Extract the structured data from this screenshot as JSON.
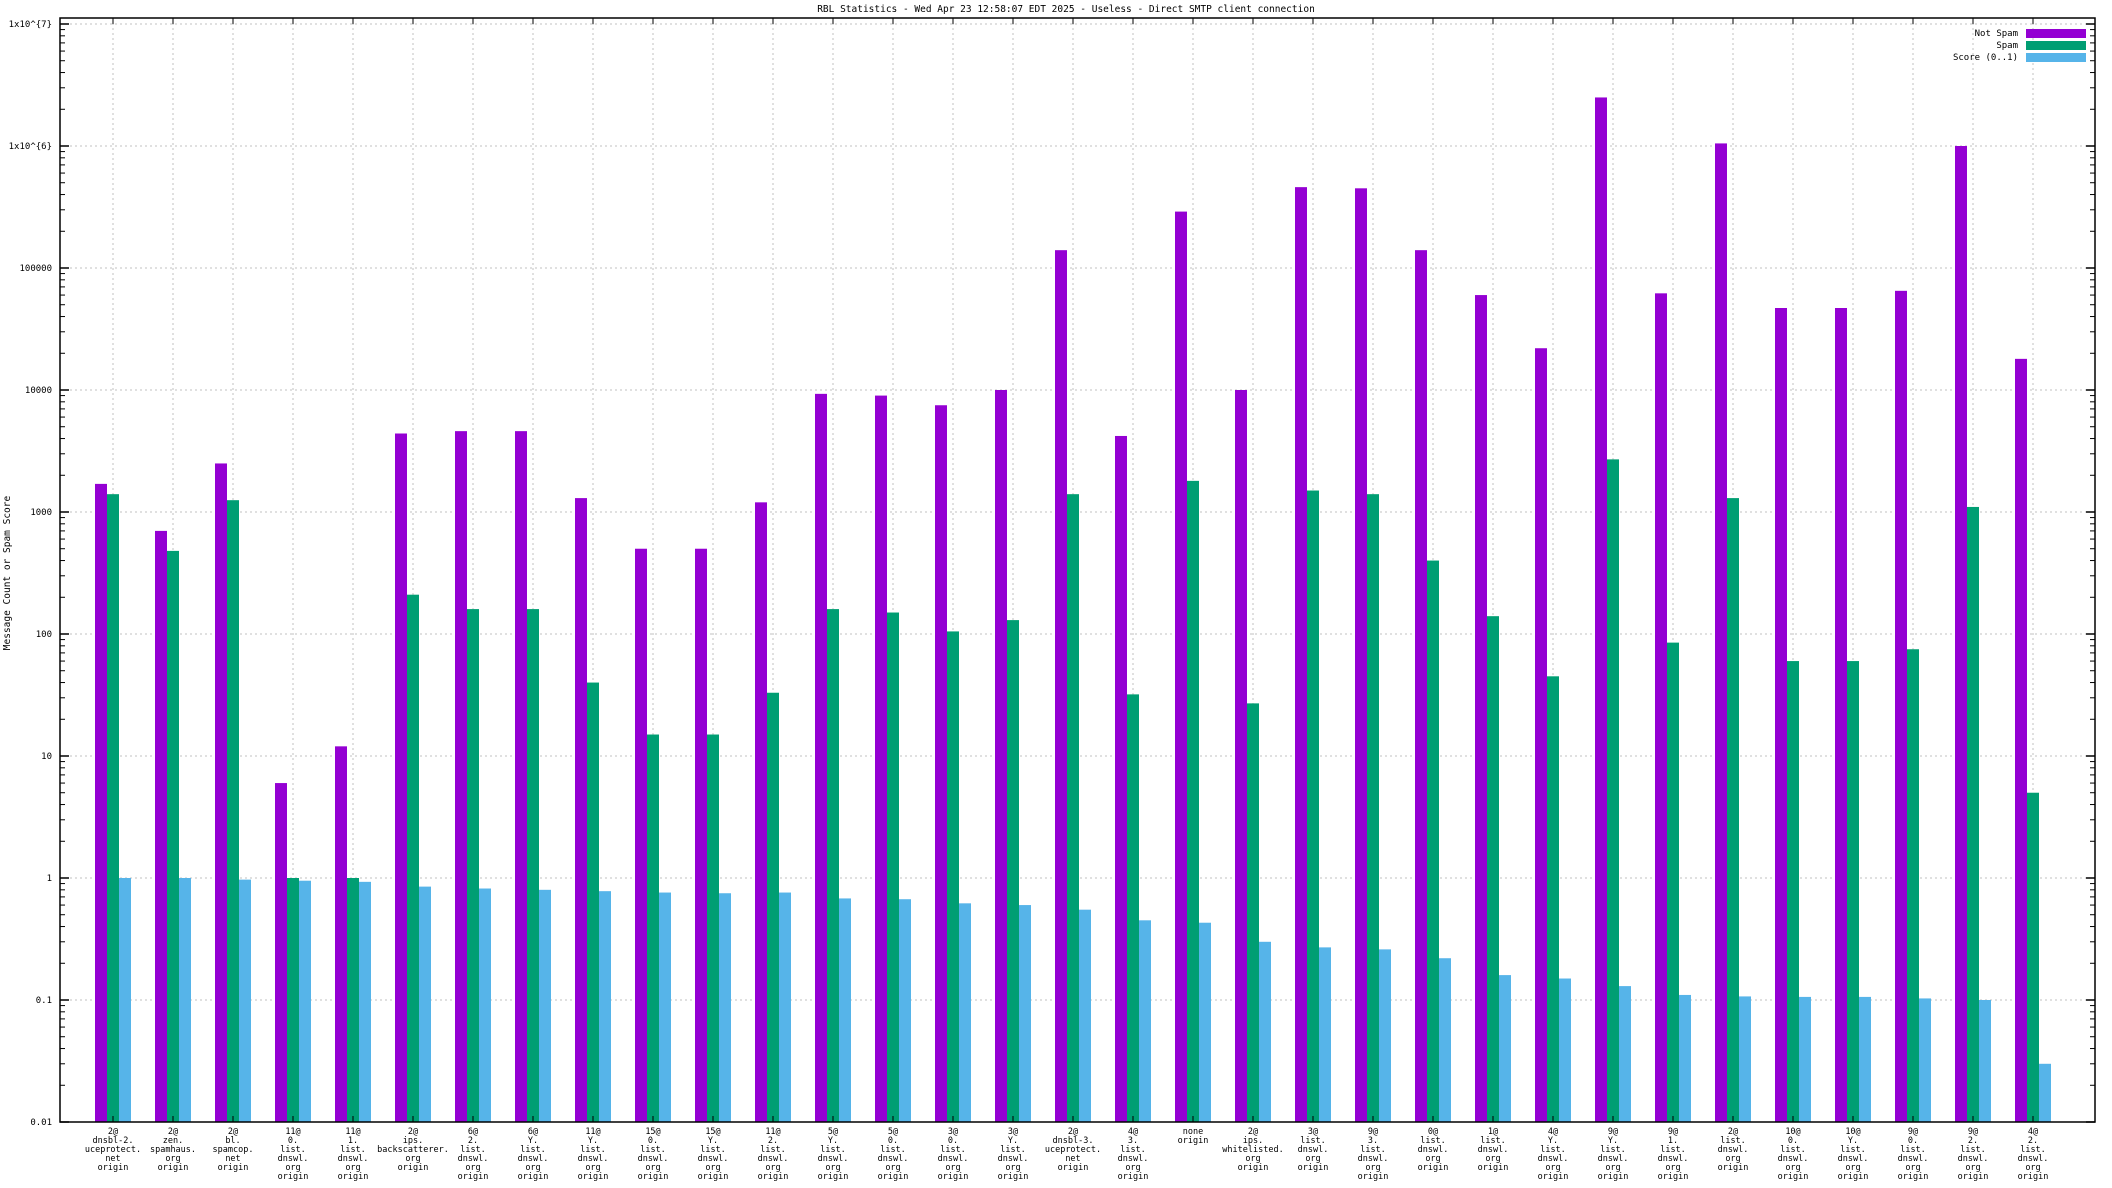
{
  "window": {
    "title": "RBL Statistics - Wed Apr 23 12:58:07 EDT 2025 - Useless - Direct SMTP client connection"
  },
  "colors": {
    "not_spam": "#9400d3",
    "spam": "#009e73",
    "score": "#56b4e9",
    "grid": "#c0c0c0",
    "border": "#000000",
    "background": "#ffffff"
  },
  "chart_data": {
    "type": "bar",
    "title": "RBL Statistics - Wed Apr 23 12:58:07 EDT 2025 - Useless - Direct SMTP client connection",
    "xlabel": "",
    "ylabel": "Message Count or Spam Score",
    "yscale": "log",
    "ylim": [
      0.01,
      10000000
    ],
    "grid": true,
    "legend_position": "top-right",
    "ytick_labels": [
      "1x10^{7}",
      "1x10^{6}",
      "100000",
      "10000",
      "1000",
      "100",
      "10",
      "1",
      "0.1",
      "0.01"
    ],
    "ytick_values": [
      10000000,
      1000000,
      100000,
      10000,
      1000,
      100,
      10,
      1,
      0.1,
      0.01
    ],
    "categories": [
      [
        "2@",
        "dnsbl-2.",
        "uceprotect.",
        "net",
        "origin"
      ],
      [
        "2@",
        "zen.",
        "spamhaus.",
        "org",
        "origin"
      ],
      [
        "2@",
        "bl.",
        "spamcop.",
        "net",
        "origin"
      ],
      [
        "11@",
        "0.",
        "list.",
        "dnswl.",
        "org",
        "origin"
      ],
      [
        "11@",
        "1.",
        "list.",
        "dnswl.",
        "org",
        "origin"
      ],
      [
        "2@",
        "ips.",
        "backscatterer.",
        "org",
        "origin"
      ],
      [
        "6@",
        "2.",
        "list.",
        "dnswl.",
        "org",
        "origin"
      ],
      [
        "6@",
        "Y.",
        "list.",
        "dnswl.",
        "org",
        "origin"
      ],
      [
        "11@",
        "Y.",
        "list.",
        "dnswl.",
        "org",
        "origin"
      ],
      [
        "15@",
        "0.",
        "list.",
        "dnswl.",
        "org",
        "origin"
      ],
      [
        "15@",
        "Y.",
        "list.",
        "dnswl.",
        "org",
        "origin"
      ],
      [
        "11@",
        "2.",
        "list.",
        "dnswl.",
        "org",
        "origin"
      ],
      [
        "5@",
        "Y.",
        "list.",
        "dnswl.",
        "org",
        "origin"
      ],
      [
        "5@",
        "0.",
        "list.",
        "dnswl.",
        "org",
        "origin"
      ],
      [
        "3@",
        "0.",
        "list.",
        "dnswl.",
        "org",
        "origin"
      ],
      [
        "3@",
        "Y.",
        "list.",
        "dnswl.",
        "org",
        "origin"
      ],
      [
        "2@",
        "dnsbl-3.",
        "uceprotect.",
        "net",
        "origin"
      ],
      [
        "4@",
        "3.",
        "list.",
        "dnswl.",
        "org",
        "origin"
      ],
      [
        "none",
        "origin"
      ],
      [
        "2@",
        "ips.",
        "whitelisted.",
        "org",
        "origin"
      ],
      [
        "3@",
        "list.",
        "dnswl.",
        "org",
        "origin"
      ],
      [
        "9@",
        "3.",
        "list.",
        "dnswl.",
        "org",
        "origin"
      ],
      [
        "0@",
        "list.",
        "dnswl.",
        "org",
        "origin"
      ],
      [
        "1@",
        "list.",
        "dnswl.",
        "org",
        "origin"
      ],
      [
        "4@",
        "Y.",
        "list.",
        "dnswl.",
        "org",
        "origin"
      ],
      [
        "9@",
        "Y.",
        "list.",
        "dnswl.",
        "org",
        "origin"
      ],
      [
        "9@",
        "1.",
        "list.",
        "dnswl.",
        "org",
        "origin"
      ],
      [
        "2@",
        "list.",
        "dnswl.",
        "org",
        "origin"
      ],
      [
        "10@",
        "0.",
        "list.",
        "dnswl.",
        "org",
        "origin"
      ],
      [
        "10@",
        "Y.",
        "list.",
        "dnswl.",
        "org",
        "origin"
      ],
      [
        "9@",
        "0.",
        "list.",
        "dnswl.",
        "org",
        "origin"
      ],
      [
        "9@",
        "2.",
        "list.",
        "dnswl.",
        "org",
        "origin"
      ],
      [
        "4@",
        "2.",
        "list.",
        "dnswl.",
        "org",
        "origin"
      ]
    ],
    "series": [
      {
        "name": "Not Spam",
        "color": "#9400d3",
        "values": [
          1700,
          700,
          2500,
          6,
          12,
          4400,
          4600,
          4600,
          1300,
          500,
          500,
          1200,
          9300,
          9000,
          7500,
          10000,
          140000,
          4200,
          290000,
          10000,
          460000,
          450000,
          140000,
          60000,
          22000,
          2500000,
          62000,
          1050000,
          47000,
          47000,
          65000,
          1000000,
          18000
        ]
      },
      {
        "name": "Spam",
        "color": "#009e73",
        "values": [
          1400,
          480,
          1250,
          1,
          1,
          210,
          160,
          160,
          40,
          15,
          15,
          33,
          160,
          150,
          105,
          130,
          1400,
          32,
          1800,
          27,
          1500,
          1400,
          400,
          140,
          45,
          2700,
          85,
          1300,
          60,
          60,
          75,
          1100,
          5
        ]
      },
      {
        "name": "Score (0..1)",
        "color": "#56b4e9",
        "values": [
          1.0,
          1.0,
          0.97,
          0.95,
          0.93,
          0.85,
          0.82,
          0.8,
          0.78,
          0.76,
          0.75,
          0.76,
          0.68,
          0.67,
          0.62,
          0.6,
          0.55,
          0.45,
          0.43,
          0.3,
          0.27,
          0.26,
          0.22,
          0.16,
          0.15,
          0.13,
          0.11,
          0.107,
          0.106,
          0.106,
          0.103,
          0.1,
          0.03
        ]
      }
    ]
  }
}
